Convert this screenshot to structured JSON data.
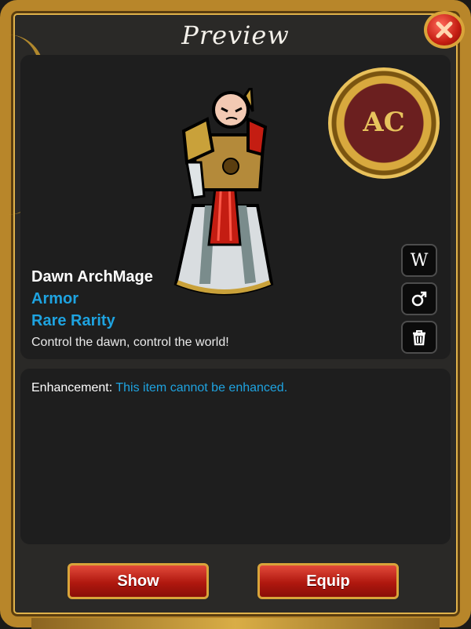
{
  "window": {
    "title": "Preview",
    "close_label": "X"
  },
  "item": {
    "name": "Dawn ArchMage",
    "type": "Armor",
    "rarity": "Rare Rarity",
    "description": "Control the dawn, control the world!"
  },
  "badge": {
    "text": "AC",
    "icon": "ac-coin-icon"
  },
  "side_buttons": {
    "wiki_label": "W",
    "gender_icon": "male-symbol-icon",
    "delete_icon": "trash-icon"
  },
  "enhancement": {
    "label": "Enhancement:",
    "value": "This item cannot be enhanced."
  },
  "buttons": {
    "show": "Show",
    "equip": "Equip"
  },
  "colors": {
    "accent_blue": "#1ea3e0",
    "gold": "#d9a43a",
    "button_red": "#b0180f",
    "panel": "#1e1e1e"
  }
}
